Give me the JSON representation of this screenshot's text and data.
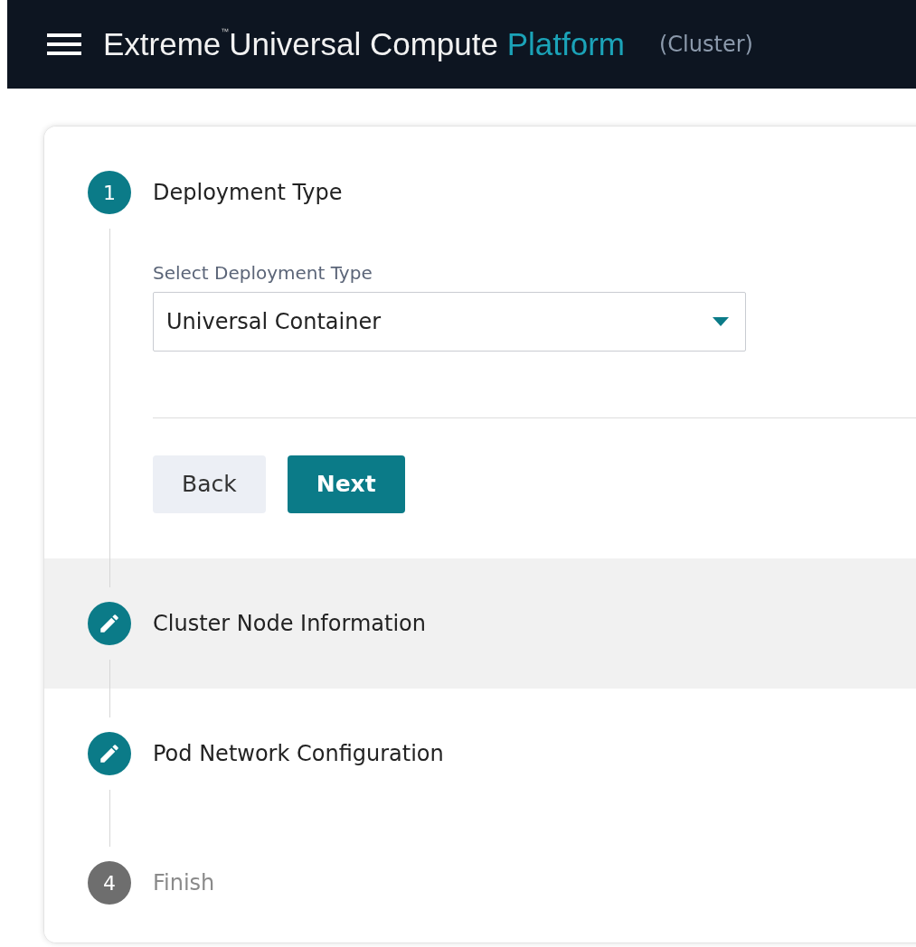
{
  "header": {
    "title_parts": [
      {
        "text": "Extreme",
        "kind": "plain"
      },
      {
        "text": "™",
        "kind": "mark"
      },
      {
        "text": "Universal Compute",
        "kind": "plain"
      },
      {
        "text": "Platform",
        "kind": "accent"
      }
    ],
    "context": "(Cluster)"
  },
  "steps": [
    {
      "number": "1",
      "label": "Deployment Type",
      "kind": "number",
      "disabled": false,
      "highlighted": false,
      "field": {
        "label": "Select Deployment Type",
        "value": "Universal Container"
      },
      "buttons": [
        {
          "label": "Back",
          "kind": "secondary"
        },
        {
          "label": "Next",
          "kind": "primary"
        }
      ]
    },
    {
      "label": "Cluster Node Information",
      "kind": "edit",
      "disabled": false,
      "highlighted": true
    },
    {
      "label": "Pod Network Configuration",
      "kind": "edit",
      "disabled": false,
      "highlighted": false
    },
    {
      "number": "4",
      "label": "Finish",
      "kind": "number",
      "disabled": true,
      "highlighted": false
    }
  ]
}
